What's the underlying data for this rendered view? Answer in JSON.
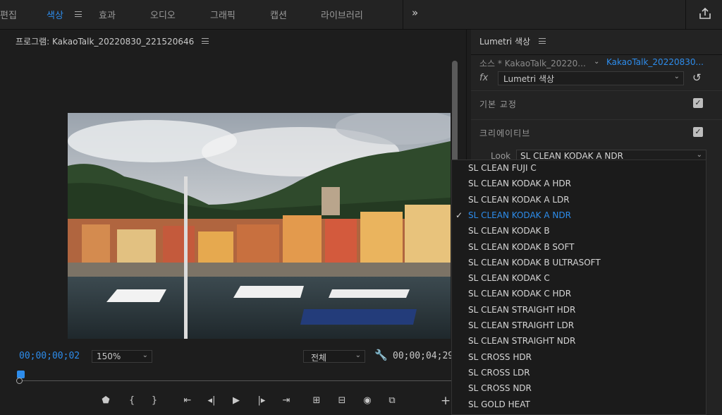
{
  "workspaces": {
    "edit": "편집",
    "color": "색상",
    "effects": "효과",
    "audio": "오디오",
    "graphics": "그래픽",
    "captions": "캡션",
    "libraries": "라이브러리"
  },
  "program": {
    "title": "프로그램: KakaoTalk_20220830_221520646",
    "timecode_current": "00;00;00;02",
    "zoom": "150%",
    "quality": "전체",
    "timecode_duration": "00;00;04;29"
  },
  "lumetri": {
    "title": "Lumetri 색상",
    "source_tab": "소스 * KakaoTalk_20220...",
    "sequence_tab": "KakaoTalk_20220830...",
    "fx_label": "fx",
    "effect_select": "Lumetri 색상",
    "basic_correction": {
      "label": "기본 교정",
      "checked": true
    },
    "creative": {
      "label": "크리에이티브",
      "checked": true
    },
    "look_label": "Look",
    "look_value": "SL CLEAN KODAK A NDR"
  },
  "look_options": [
    {
      "label": "SL CLEAN FUJI C",
      "selected": false
    },
    {
      "label": "SL CLEAN KODAK A HDR",
      "selected": false
    },
    {
      "label": "SL CLEAN KODAK A LDR",
      "selected": false
    },
    {
      "label": "SL CLEAN KODAK A NDR",
      "selected": true
    },
    {
      "label": "SL CLEAN KODAK B",
      "selected": false
    },
    {
      "label": "SL CLEAN KODAK B SOFT",
      "selected": false
    },
    {
      "label": "SL CLEAN KODAK B ULTRASOFT",
      "selected": false
    },
    {
      "label": "SL CLEAN KODAK C",
      "selected": false
    },
    {
      "label": "SL CLEAN KODAK C HDR",
      "selected": false
    },
    {
      "label": "SL CLEAN STRAIGHT HDR",
      "selected": false
    },
    {
      "label": "SL CLEAN STRAIGHT LDR",
      "selected": false
    },
    {
      "label": "SL CLEAN STRAIGHT NDR",
      "selected": false
    },
    {
      "label": "SL CROSS HDR",
      "selected": false
    },
    {
      "label": "SL CROSS LDR",
      "selected": false
    },
    {
      "label": "SL CROSS NDR",
      "selected": false
    },
    {
      "label": "SL GOLD HEAT",
      "selected": false
    }
  ],
  "colors": {
    "accent": "#2d8ceb",
    "panel": "#232323",
    "background": "#1d1d1d"
  }
}
